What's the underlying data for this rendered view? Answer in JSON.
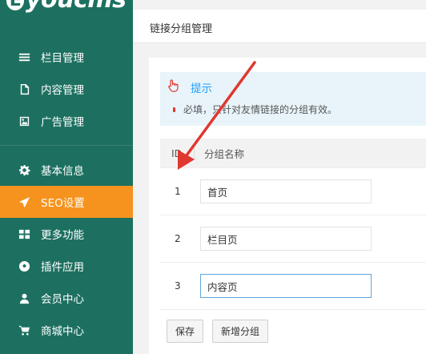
{
  "brand": {
    "logo_text": "youcms",
    "logo_letter": "E"
  },
  "sidebar": {
    "items": [
      {
        "label": "栏目管理",
        "icon": "list-icon"
      },
      {
        "label": "内容管理",
        "icon": "document-icon"
      },
      {
        "label": "广告管理",
        "icon": "image-icon"
      },
      {
        "label": "基本信息",
        "icon": "gear-icon"
      },
      {
        "label": "SEO设置",
        "icon": "paper-plane-icon",
        "active": true
      },
      {
        "label": "更多功能",
        "icon": "grid-icon"
      },
      {
        "label": "插件应用",
        "icon": "soccer-ball-icon"
      },
      {
        "label": "会员中心",
        "icon": "user-icon"
      },
      {
        "label": "商城中心",
        "icon": "cart-icon"
      }
    ]
  },
  "header": {
    "title": "链接分组管理"
  },
  "tip": {
    "title": "提示",
    "body": "必填，只针对友情链接的分组有效。"
  },
  "table": {
    "columns": [
      "ID",
      "分组名称"
    ],
    "rows": [
      {
        "id": "1",
        "name": "首页"
      },
      {
        "id": "2",
        "name": "栏目页"
      },
      {
        "id": "3",
        "name": "内容页"
      }
    ]
  },
  "buttons": {
    "save": "保存",
    "add_group": "新增分组"
  },
  "colors": {
    "sidebar": "#1d7060",
    "active": "#f5931e",
    "tip_text": "#1e9fff",
    "arrow": "#e0372f"
  }
}
